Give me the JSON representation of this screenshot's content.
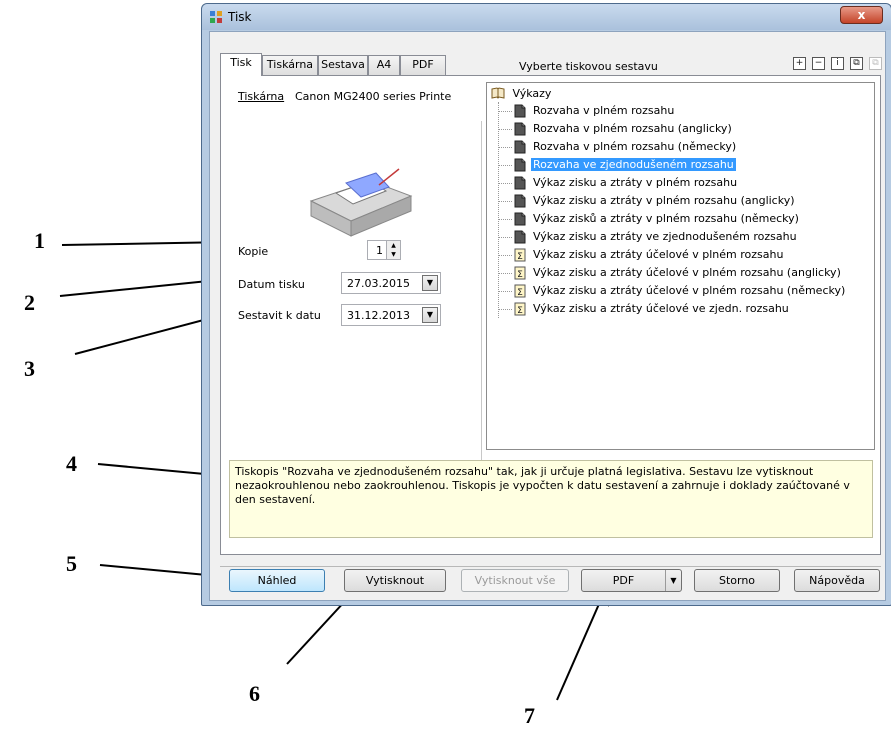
{
  "window": {
    "title": "Tisk",
    "close_label": "x"
  },
  "tabs": [
    {
      "label": "Tisk",
      "active": true
    },
    {
      "label": "Tiskárna"
    },
    {
      "label": "Sestava"
    },
    {
      "label": "A4"
    },
    {
      "label": "PDF"
    }
  ],
  "section_label": "Vyberte tiskovou sestavu",
  "toolbar_icons": [
    "add-icon",
    "remove-icon",
    "info-icon",
    "copy-icon",
    "disabled-icon"
  ],
  "printer": {
    "label": "Tiskárna",
    "name": "Canon MG2400 series Printe"
  },
  "copies": {
    "label": "Kopie",
    "value": "1"
  },
  "print_date": {
    "label": "Datum tisku",
    "value": "27.03.2015"
  },
  "compile_date": {
    "label": "Sestavit k datu",
    "value": "31.12.2013"
  },
  "tree": {
    "root": "Výkazy",
    "items": [
      {
        "label": "Rozvaha v plném rozsahu",
        "icon": "doc"
      },
      {
        "label": "Rozvaha v plném rozsahu (anglicky)",
        "icon": "doc"
      },
      {
        "label": "Rozvaha v plném rozsahu (německy)",
        "icon": "doc"
      },
      {
        "label": "Rozvaha ve zjednodušeném rozsahu",
        "icon": "doc",
        "selected": true
      },
      {
        "label": "Výkaz zisku a ztráty v plném rozsahu",
        "icon": "doc"
      },
      {
        "label": "Výkaz zisku a ztráty v plném rozsahu (anglicky)",
        "icon": "doc"
      },
      {
        "label": "Výkaz zisků a ztráty v plném rozsahu (německy)",
        "icon": "doc"
      },
      {
        "label": "Výkaz zisku a ztráty ve zjednodušeném rozsahu",
        "icon": "doc"
      },
      {
        "label": "Výkaz zisku a ztráty účelové v plném rozsahu",
        "icon": "sigma"
      },
      {
        "label": "Výkaz zisku a ztráty účelové v plném rozsahu (anglicky)",
        "icon": "sigma"
      },
      {
        "label": "Výkaz zisku a ztráty účelové v plném rozsahu (německy)",
        "icon": "sigma"
      },
      {
        "label": "Výkaz zisku a ztráty účelové ve zjedn. rozsahu",
        "icon": "sigma"
      }
    ]
  },
  "description": "Tiskopis \"Rozvaha ve zjednodušeném rozsahu\" tak, jak ji určuje platná legislativa. Sestavu lze vytisknout nezaokrouhlenou nebo zaokrouhlenou. Tiskopis je vypočten k datu sestavení a zahrnuje i doklady zaúčtované v den sestavení.",
  "buttons": {
    "preview": "Náhled",
    "print": "Vytisknout",
    "print_all": "Vytisknout vše",
    "pdf": "PDF",
    "cancel": "Storno",
    "help": "Nápověda"
  },
  "callouts": [
    "1",
    "2",
    "3",
    "4",
    "5",
    "6",
    "7"
  ],
  "colors": {
    "selection": "#3399ff",
    "description_bg": "#ffffe1",
    "frame": "#b6cbe2"
  }
}
